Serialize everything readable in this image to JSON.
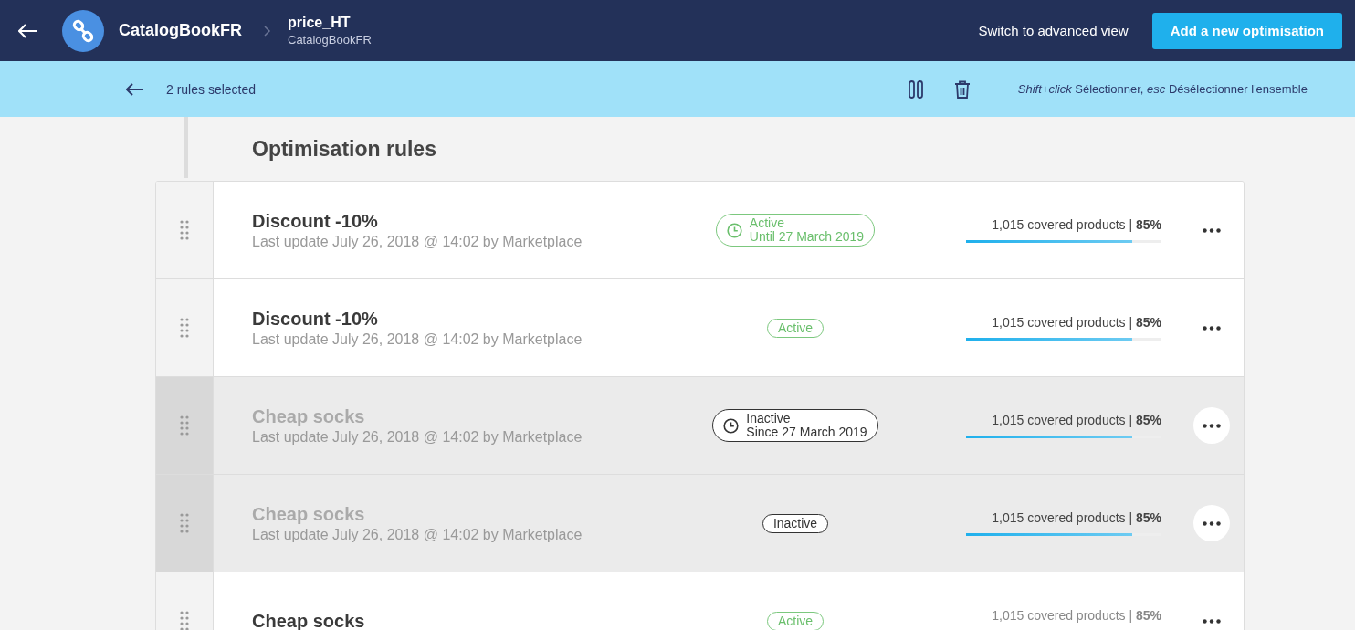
{
  "header": {
    "catalog": "CatalogBookFR",
    "breadcrumb": {
      "title": "price_HT",
      "subtitle": "CatalogBookFR"
    },
    "advanced_link": "Switch to advanced view",
    "add_button": "Add a new optimisation"
  },
  "selection_bar": {
    "count": "2 rules selected",
    "hint": "*Shift+click* Sélectionner,  *esc* Désélectionner l'ensemble"
  },
  "section_title": "Optimisation rules",
  "rules": [
    {
      "name": "Discount -10%",
      "updated": "Last update July 26, 2018 @ 14:02 by Marketplace",
      "selected": false,
      "status": {
        "kind": "active",
        "label": "Active",
        "date": "Until 27 March 2019"
      },
      "coverage": "1,015 covered products | **85%**",
      "level": 0.85
    },
    {
      "name": "Discount -10%",
      "updated": "Last update July 26, 2018 @ 14:02 by Marketplace",
      "selected": false,
      "status": {
        "kind": "active",
        "label": "Active"
      },
      "coverage": "1,015 covered products | **85%**",
      "level": 0.85
    },
    {
      "name": "Cheap socks",
      "updated": "Last update July 26, 2018 @ 14:02 by Marketplace",
      "selected": true,
      "status": {
        "kind": "inactive",
        "label": "Inactive",
        "date": "Since 27 March 2019"
      },
      "coverage": "1,015 covered products | **85%**",
      "level": 0.85
    },
    {
      "name": "Cheap socks",
      "updated": "Last update July 26, 2018 @ 14:02 by Marketplace",
      "selected": true,
      "status": {
        "kind": "inactive",
        "label": "Inactive"
      },
      "coverage": "1,015 covered products | **85%**",
      "level": 0.85
    },
    {
      "name": "Cheap socks",
      "selected": false,
      "status": {
        "kind": "active",
        "label": "Active"
      },
      "coverage": "1,015 covered products | **85%**"
    }
  ]
}
